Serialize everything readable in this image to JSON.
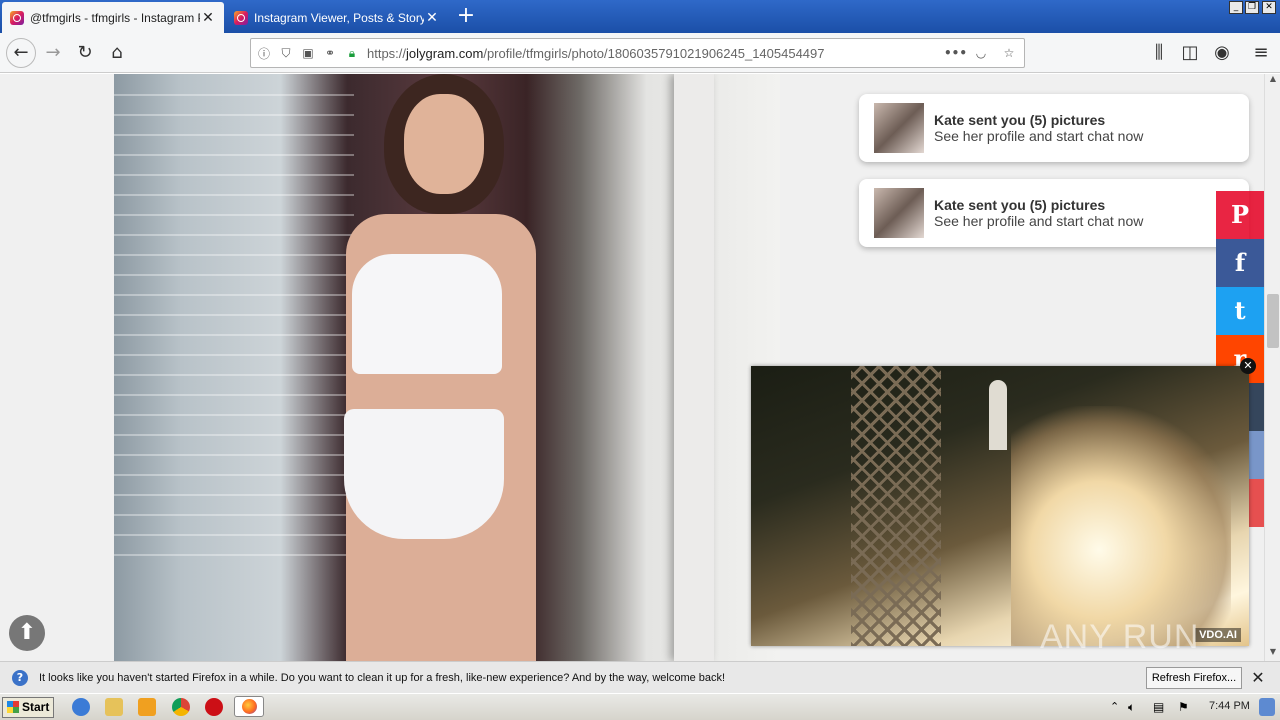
{
  "browser": {
    "tabs": [
      {
        "title": "@tfmgirls - tfmgirls - Instagram Po",
        "active": true
      },
      {
        "title": "Instagram Viewer, Posts & Story",
        "active": false
      }
    ],
    "url_prefix": "https://",
    "url_domain": "jolygram.com",
    "url_path": "/profile/tfmgirls/photo/1806035791021906245_1405454497"
  },
  "notifications": [
    {
      "title": "Kate sent you (5) pictures",
      "subtitle": "See her profile and start chat now"
    },
    {
      "title": "Kate sent you (5) pictures",
      "subtitle": "See her profile and start chat now"
    }
  ],
  "share": [
    {
      "icon": "pinterest-icon",
      "glyph": "P",
      "color": "#e60023"
    },
    {
      "icon": "facebook-icon",
      "glyph": "f",
      "color": "#3b5998"
    },
    {
      "icon": "twitter-icon",
      "glyph": "t",
      "color": "#1da1f2"
    },
    {
      "icon": "reddit-icon",
      "glyph": "r",
      "color": "#ff4500"
    }
  ],
  "video": {
    "brand": "VDO.AI"
  },
  "watermark": "ANY RUN",
  "notification_bar": {
    "message": "It looks like you haven't started Firefox in a while. Do you want to clean it up for a fresh, like-new experience? And by the way, welcome back!",
    "button": "Refresh Firefox..."
  },
  "taskbar": {
    "start": "Start",
    "clock": "7:44 PM"
  }
}
